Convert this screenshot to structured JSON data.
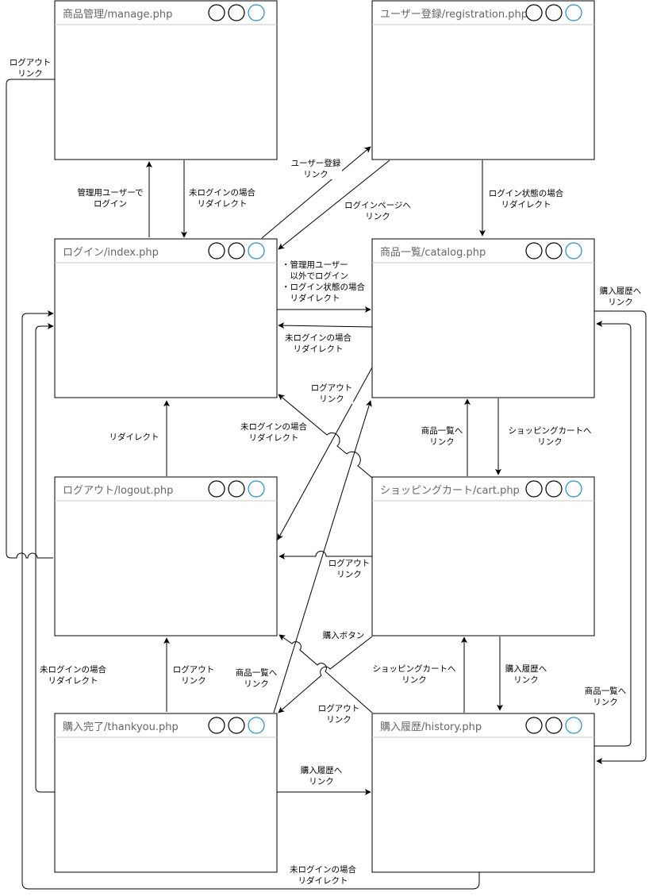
{
  "pages": {
    "manage": {
      "title": "商品管理/manage.php"
    },
    "registration": {
      "title": "ユーザー登録/registration.php"
    },
    "login": {
      "title": "ログイン/index.php"
    },
    "catalog": {
      "title": "商品一覧/catalog.php"
    },
    "logout": {
      "title": "ログアウト/logout.php"
    },
    "cart": {
      "title": "ショッピングカート/cart.php"
    },
    "thankyou": {
      "title": "購入完了/thankyou.php"
    },
    "history": {
      "title": "購入履歴/history.php"
    }
  },
  "labels": {
    "manage_logout_link": [
      "ログアウト",
      "リンク"
    ],
    "admin_user_login": [
      "管理用ユーザーで",
      "ログイン"
    ],
    "manage_not_logged_in_redirect": [
      "未ログインの場合",
      "リダイレクト"
    ],
    "user_registration_link": [
      "ユーザー登録",
      "リンク"
    ],
    "login_page_link": [
      "ログインページへ",
      "リンク"
    ],
    "registration_logged_in_redirect": [
      "ログイン状態の場合",
      "リダイレクト"
    ],
    "login_to_catalog": [
      "・管理用ユーザー",
      "　以外でログイン",
      "・ログイン状態の場合",
      "　リダイレクト"
    ],
    "catalog_not_logged_in_redirect": [
      "未ログインの場合",
      "リダイレクト"
    ],
    "catalog_history_link": [
      "購入履歴へ",
      "リンク"
    ],
    "catalog_logout_link": [
      "ログアウト",
      "リンク"
    ],
    "cart_not_logged_in_redirect": [
      "未ログインの場合",
      "リダイレクト"
    ],
    "logout_redirect": [
      "リダイレクト"
    ],
    "cart_catalog_link": [
      "商品一覧へ",
      "リンク"
    ],
    "catalog_cart_link": [
      "ショッピングカートへ",
      "リンク"
    ],
    "cart_logout_link": [
      "ログアウト",
      "リンク"
    ],
    "purchase_button": [
      "購入ボタン"
    ],
    "thankyou_not_logged_in_redirect": [
      "未ログインの場合",
      "リダイレクト"
    ],
    "thankyou_logout_link": [
      "ログアウト",
      "リンク"
    ],
    "thankyou_catalog_link": [
      "商品一覧へ",
      "リンク"
    ],
    "history_cart_link": [
      "ショッピングカートへ",
      "リンク"
    ],
    "cart_history_link": [
      "購入履歴へ",
      "リンク"
    ],
    "history_logout_link": [
      "ログアウト",
      "リンク"
    ],
    "history_catalog_link": [
      "商品一覧へ",
      "リンク"
    ],
    "thankyou_history_link": [
      "購入履歴へ",
      "リンク"
    ],
    "history_not_logged_in_redirect": [
      "未ログインの場合",
      "リダイレクト"
    ]
  },
  "colors": {
    "line": "#000000",
    "title_text": "#666666",
    "title_divider": "#c8c8c8",
    "circle_active": "#1e90d8"
  }
}
